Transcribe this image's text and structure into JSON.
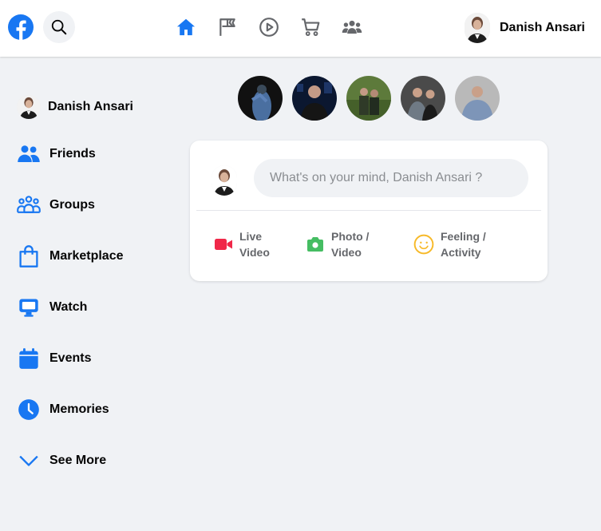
{
  "header": {
    "logo_icon": "facebook-logo-icon",
    "nav": [
      {
        "name": "home-icon",
        "active": true
      },
      {
        "name": "flag-icon",
        "active": false
      },
      {
        "name": "play-icon",
        "active": false
      },
      {
        "name": "cart-icon",
        "active": false
      },
      {
        "name": "people-group-icon",
        "active": false
      }
    ],
    "profile_name": "Danish Ansari"
  },
  "sidebar": {
    "profile_name": "Danish Ansari",
    "items": [
      {
        "label": "Friends",
        "icon": "friends-icon"
      },
      {
        "label": "Groups",
        "icon": "groups-icon"
      },
      {
        "label": "Marketplace",
        "icon": "marketplace-icon"
      },
      {
        "label": "Watch",
        "icon": "watch-icon"
      },
      {
        "label": "Events",
        "icon": "events-icon"
      },
      {
        "label": "Memories",
        "icon": "memories-icon"
      },
      {
        "label": "See More",
        "icon": "chevron-down-icon"
      }
    ]
  },
  "composer": {
    "placeholder": "What's on your mind, Danish Ansari ?",
    "actions": [
      {
        "line1": "Live",
        "line2": "Video",
        "icon": "live-video-icon"
      },
      {
        "line1": "Photo /",
        "line2": "Video",
        "icon": "camera-icon"
      },
      {
        "line1": "Feeling /",
        "line2": "Activity",
        "icon": "smiley-icon"
      }
    ]
  },
  "colors": {
    "brand": "#1877f2",
    "live": "#f02849",
    "photo": "#45bd62",
    "feeling": "#f7b928"
  }
}
